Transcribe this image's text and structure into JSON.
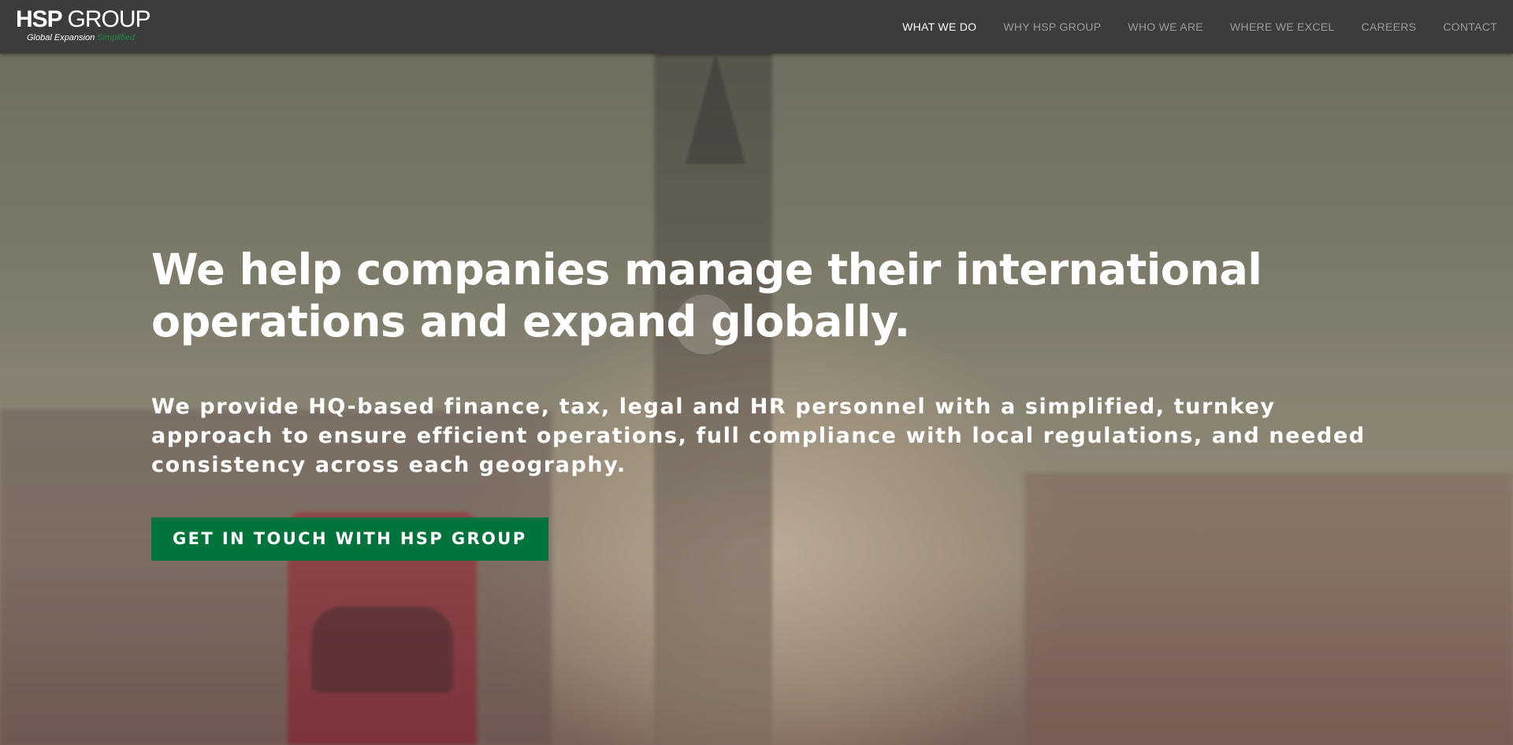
{
  "brand": {
    "logo_main_hsp": "HSP",
    "logo_main_group": "GROUP",
    "logo_tag_white": "Global Expansion",
    "logo_tag_green": "Simplified",
    "accent_color": "#00743a",
    "nav_bg_color": "#3c3c3c"
  },
  "nav": {
    "items": [
      {
        "label": "WHAT WE DO",
        "active": true
      },
      {
        "label": "WHY HSP GROUP",
        "active": false
      },
      {
        "label": "WHO WE ARE",
        "active": false
      },
      {
        "label": "WHERE WE EXCEL",
        "active": false
      },
      {
        "label": "CAREERS",
        "active": false
      },
      {
        "label": "CONTACT",
        "active": false
      }
    ]
  },
  "hero": {
    "title": "We help companies manage their international operations and expand globally.",
    "subtitle": "We provide HQ-based finance, tax, legal and HR personnel with a simplified, turnkey approach to ensure efficient operations, full compliance with local regulations, and needed consistency across each geography.",
    "cta_label": "GET IN TOUCH WITH HSP GROUP",
    "background_icon": "london-big-ben-photo"
  }
}
